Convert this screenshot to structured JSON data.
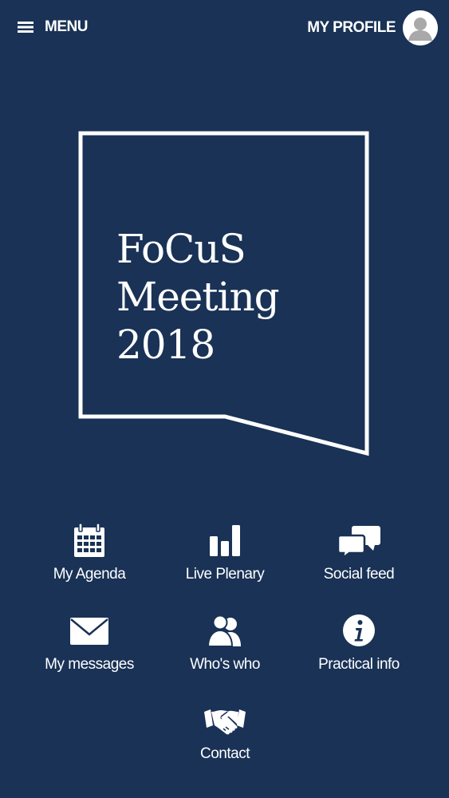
{
  "header": {
    "menu_label": "MENU",
    "profile_label": "MY PROFILE"
  },
  "event": {
    "title_line1": "FoCuS",
    "title_line2": "Meeting",
    "title_line3": "2018"
  },
  "tiles": [
    {
      "label": "My Agenda",
      "icon": "calendar-icon"
    },
    {
      "label": "Live Plenary",
      "icon": "bar-chart-icon"
    },
    {
      "label": "Social feed",
      "icon": "chat-bubbles-icon"
    },
    {
      "label": "My messages",
      "icon": "envelope-icon"
    },
    {
      "label": "Who's who",
      "icon": "people-icon"
    },
    {
      "label": "Practical info",
      "icon": "info-icon"
    },
    {
      "label": "Contact",
      "icon": "handshake-icon"
    }
  ],
  "colors": {
    "background": "#193256",
    "foreground": "#ffffff"
  }
}
